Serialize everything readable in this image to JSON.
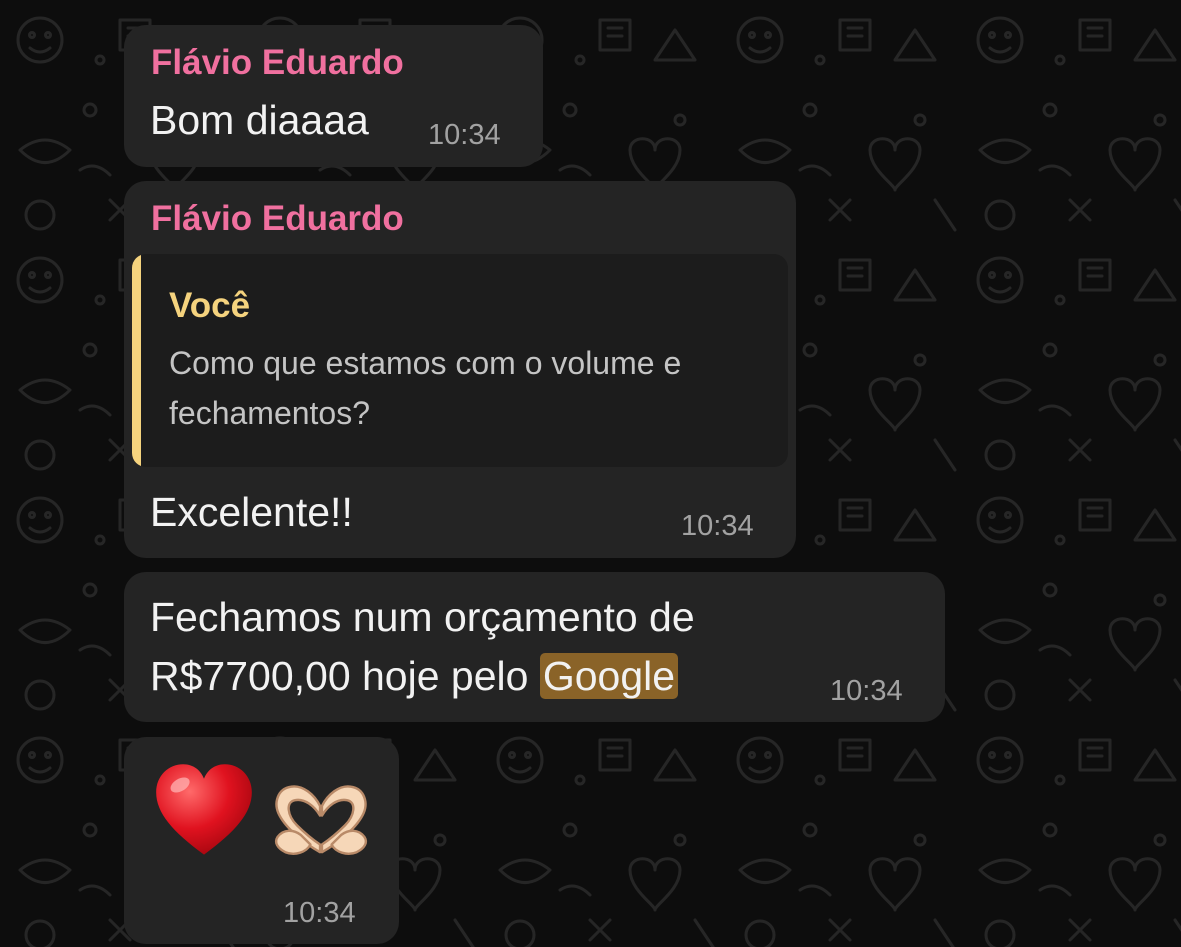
{
  "messages": [
    {
      "sender": "Flávio Eduardo",
      "text": "Bom diaaaa",
      "time": "10:34"
    },
    {
      "sender": "Flávio Eduardo",
      "reply": {
        "author": "Você",
        "line1": "Como que estamos com o volume e",
        "line2": "fechamentos?"
      },
      "text": "Excelente!!",
      "time": "10:34"
    },
    {
      "line1": "Fechamos num orçamento  de",
      "line2_prefix": "R$7700,00 hoje pelo ",
      "line2_highlight": "Google",
      "time": "10:34"
    },
    {
      "emojis": [
        "red-heart-icon",
        "heart-hands-icon"
      ],
      "time": "10:34"
    }
  ],
  "colors": {
    "background": "#0d0d0d",
    "bubble": "#242424",
    "sender_name": "#f0709f",
    "reply_accent": "#f5d37e",
    "highlight": "#8a6328",
    "message_text": "#f2f2f2",
    "timestamp": "#a2a2a2"
  }
}
